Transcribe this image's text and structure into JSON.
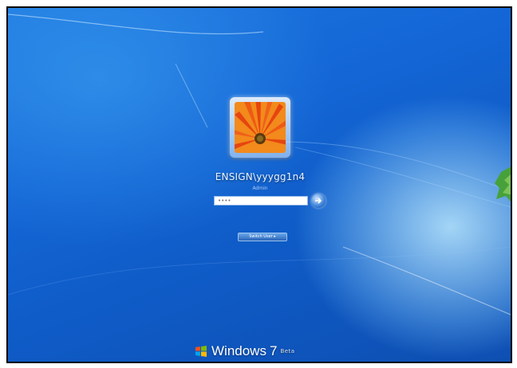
{
  "user": {
    "name": "ENSIGN\\yyygg1n4",
    "subtitle": "Admin"
  },
  "password": {
    "value": "",
    "placeholder": "••••"
  },
  "buttons": {
    "switch_user_label": "Switch User ▸"
  },
  "branding": {
    "product": "Windows",
    "version": "7",
    "edition": "Beta"
  },
  "icons": {
    "user_tile": "orange-daisy",
    "submit": "arrow-right-icon",
    "logo": "windows-flag-icon"
  },
  "colors": {
    "background": "#1466d6",
    "flower": "#e8501a"
  }
}
